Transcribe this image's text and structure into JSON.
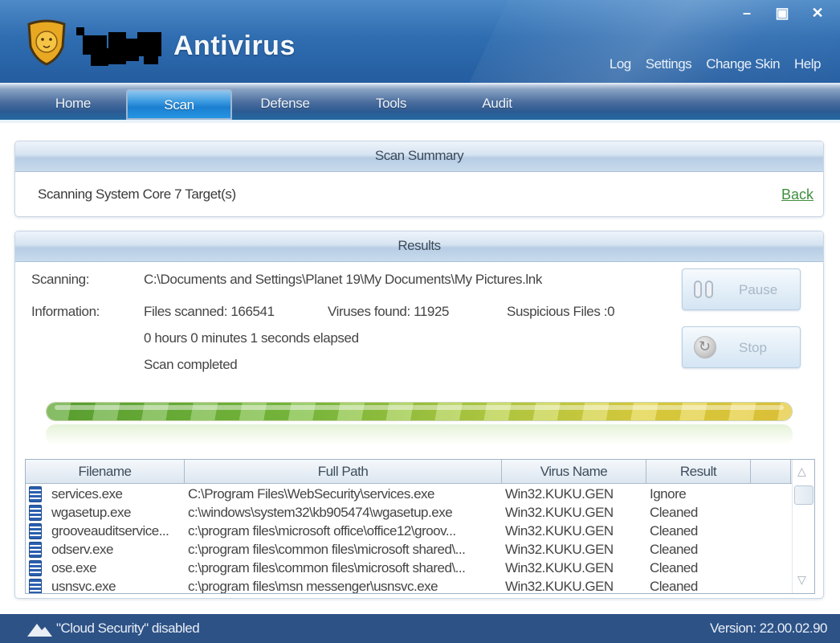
{
  "app": {
    "brand_name": "Antivirus",
    "window_controls": {
      "minimize": "–",
      "maximize": "▣",
      "close": "✕"
    },
    "top_links": [
      "Log",
      "Settings",
      "Change Skin",
      "Help"
    ]
  },
  "nav": {
    "tabs": [
      {
        "label": "Home",
        "active": false
      },
      {
        "label": "Scan",
        "active": true
      },
      {
        "label": "Defense",
        "active": false
      },
      {
        "label": "Tools",
        "active": false
      },
      {
        "label": "Audit",
        "active": false
      }
    ]
  },
  "summary": {
    "header": "Scan Summary",
    "text": "Scanning System Core 7 Target(s)",
    "back_label": "Back"
  },
  "results": {
    "header": "Results",
    "scanning_label": "Scanning:",
    "scanning_value": "C:\\Documents and Settings\\Planet 19\\My Documents\\My Pictures.lnk",
    "information_label": "Information:",
    "files_scanned": "Files scanned: 166541",
    "viruses_found": "Viruses found: 11925",
    "suspicious_files": "Suspicious Files :0",
    "elapsed": "0 hours 0 minutes 1 seconds elapsed",
    "status": "Scan completed",
    "pause_label": "Pause",
    "stop_label": "Stop",
    "progress_percent": 100,
    "colors": {
      "progress_start": "#5ca632",
      "progress_end": "#e6c93a",
      "back_link": "#3d8f3d"
    }
  },
  "table": {
    "columns": [
      "Filename",
      "Full Path",
      "Virus Name",
      "Result",
      ""
    ],
    "rows": [
      {
        "filename": "services.exe",
        "path": "C:\\Program Files\\WebSecurity\\services.exe",
        "virus": "Win32.KUKU.GEN",
        "result": "Ignore"
      },
      {
        "filename": "wgasetup.exe",
        "path": "c:\\windows\\system32\\kb905474\\wgasetup.exe",
        "virus": "Win32.KUKU.GEN",
        "result": "Cleaned"
      },
      {
        "filename": "grooveauditservice...",
        "path": "c:\\program files\\microsoft office\\office12\\groov...",
        "virus": "Win32.KUKU.GEN",
        "result": "Cleaned"
      },
      {
        "filename": "odserv.exe",
        "path": "c:\\program files\\common files\\microsoft shared\\...",
        "virus": "Win32.KUKU.GEN",
        "result": "Cleaned"
      },
      {
        "filename": "ose.exe",
        "path": "c:\\program files\\common files\\microsoft shared\\...",
        "virus": "Win32.KUKU.GEN",
        "result": "Cleaned"
      },
      {
        "filename": "usnsvc.exe",
        "path": "c:\\program files\\msn messenger\\usnsvc.exe",
        "virus": "Win32.KUKU.GEN",
        "result": "Cleaned"
      }
    ],
    "scroll_up": "△",
    "scroll_down": "▽"
  },
  "statusbar": {
    "cloud_status": "\"Cloud Security\" disabled",
    "version": "Version: 22.00.02.90"
  }
}
